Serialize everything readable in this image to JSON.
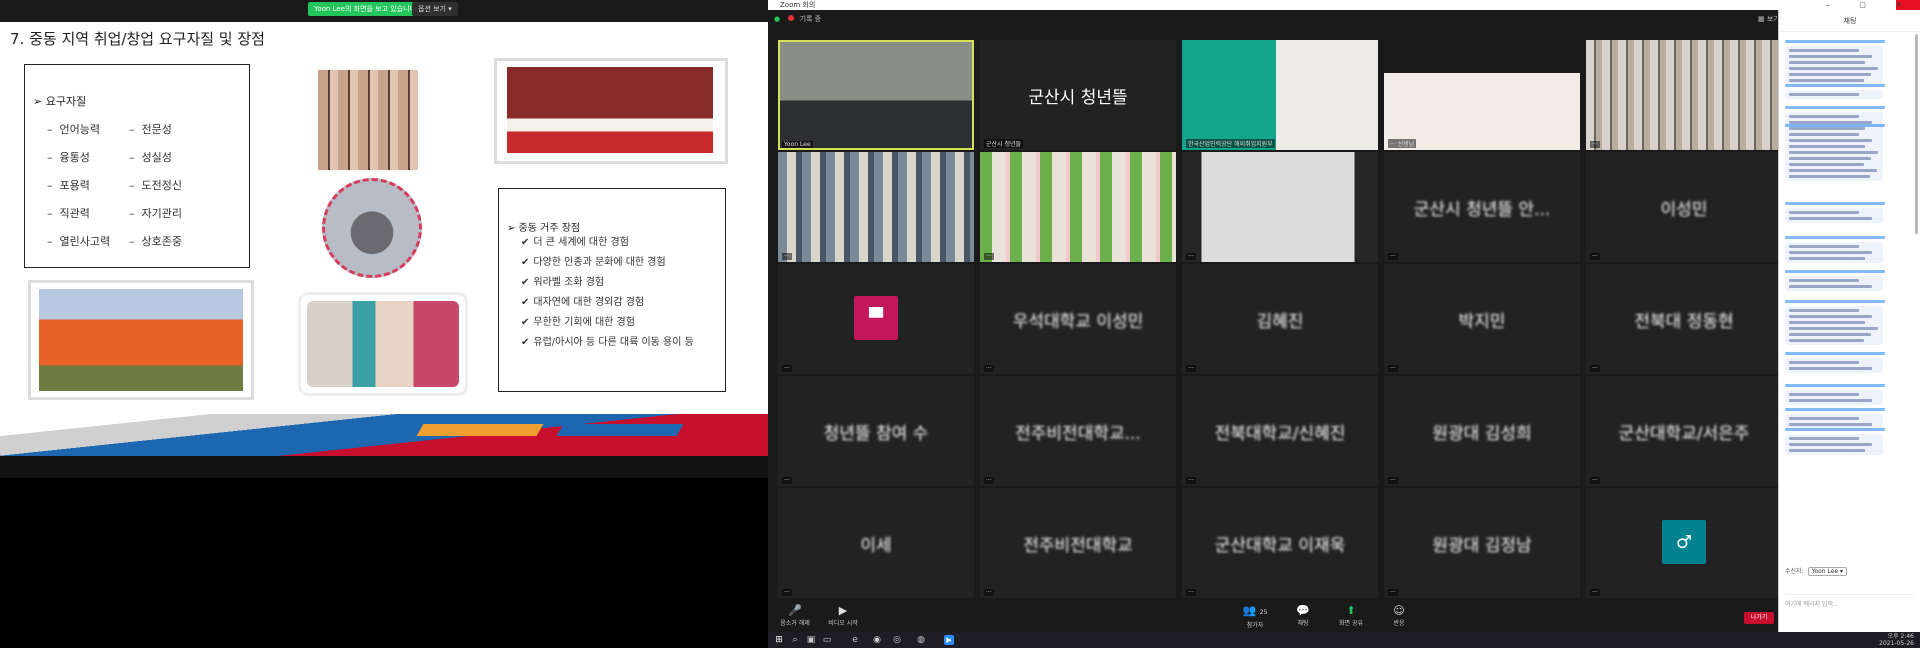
{
  "share": {
    "viewing_notice": "Yoon Lee의 화면을 보고 있습니다.",
    "view_options": "옵션 보기 ▾"
  },
  "slide": {
    "title": "7. 중동 지역 취업/창업 요구자질 및 장점",
    "requirements_header": "➢ 요구자질",
    "requirements_col1": [
      "언어능력",
      "융통성",
      "포용력",
      "직관력",
      "열린사고력"
    ],
    "requirements_col2": [
      "전문성",
      "성실성",
      "도전정신",
      "자기관리",
      "상호존중"
    ],
    "residence_header": "➢ 중동 거주 장점",
    "residence_items": [
      "더 큰 세계에 대한 경험",
      "다양한 인종과 문화에 대한 경험",
      "워라벨 조화 경험",
      "대자연에 대한 경외감 경험",
      "무한한 기회에 대한 경험",
      "유럽/아시아 등 다른 대륙 이동 용이 등"
    ]
  },
  "zoom": {
    "window_title": "Zoom 회의",
    "recording_label": "기록 중",
    "view_label": "보기",
    "tiles": [
      {
        "kind": "video",
        "style": "vid-1",
        "name": "Yoon Lee",
        "active": true
      },
      {
        "kind": "text",
        "big": "군산시 청년뜰",
        "clear": true,
        "name": "군산시 청년뜰"
      },
      {
        "kind": "video",
        "style": "vid-3",
        "name": "한국산업인력공단 해외취업지원부"
      },
      {
        "kind": "video",
        "style": "vid-4",
        "name": "··· 선생님"
      },
      {
        "kind": "video",
        "style": "vid-5",
        "name": "···"
      },
      {
        "kind": "video",
        "style": "vid-6",
        "name": "···"
      },
      {
        "kind": "video",
        "style": "vid-7",
        "name": "···"
      },
      {
        "kind": "video",
        "style": "vid-8",
        "name": "···"
      },
      {
        "kind": "text",
        "big": "군산시 청년뜰 안...",
        "name": "···"
      },
      {
        "kind": "text",
        "big": "이성민",
        "name": "···"
      },
      {
        "kind": "avatar",
        "avatar_color": "#c2185b",
        "avatar_glyph": "▀",
        "name": "···"
      },
      {
        "kind": "text",
        "big": "우석대학교 이성민",
        "name": "···"
      },
      {
        "kind": "text",
        "big": "김혜진",
        "name": "···"
      },
      {
        "kind": "text",
        "big": "박지민",
        "name": "···"
      },
      {
        "kind": "text",
        "big": "전북대 정동현",
        "name": "···"
      },
      {
        "kind": "text",
        "big": "청년뜰 참여 수",
        "name": "···"
      },
      {
        "kind": "text",
        "big": "전주비전대학교...",
        "name": "···"
      },
      {
        "kind": "text",
        "big": "전북대학교/신혜진",
        "name": "···"
      },
      {
        "kind": "text",
        "big": "원광대 김성희",
        "name": "···"
      },
      {
        "kind": "text",
        "big": "군산대학교/서은주",
        "name": "···"
      },
      {
        "kind": "text",
        "big": "이세",
        "name": "···"
      },
      {
        "kind": "text",
        "big": "전주비전대학교",
        "name": "···"
      },
      {
        "kind": "text",
        "big": "군산대학교 이재욱",
        "name": "···"
      },
      {
        "kind": "text",
        "big": "원광대 김정남",
        "name": "···"
      },
      {
        "kind": "avatar",
        "avatar_color": "#00838f",
        "avatar_glyph": "♂",
        "name": "···"
      }
    ],
    "toolbar": {
      "mute": "음소거 해제",
      "video": "비디오 시작",
      "participants": "참가자",
      "participants_count": "25",
      "chat": "채팅",
      "share": "화면 공유",
      "reactions": "반응",
      "leave": "나가기"
    },
    "chat": {
      "header": "채팅",
      "to_label": "수신자:",
      "to_value": "Yoon Lee ▾",
      "input_placeholder": "여기에 메시지 입력..."
    }
  },
  "taskbar": {
    "clock_time": "오후 2:46",
    "clock_date": "2021-05-26"
  }
}
